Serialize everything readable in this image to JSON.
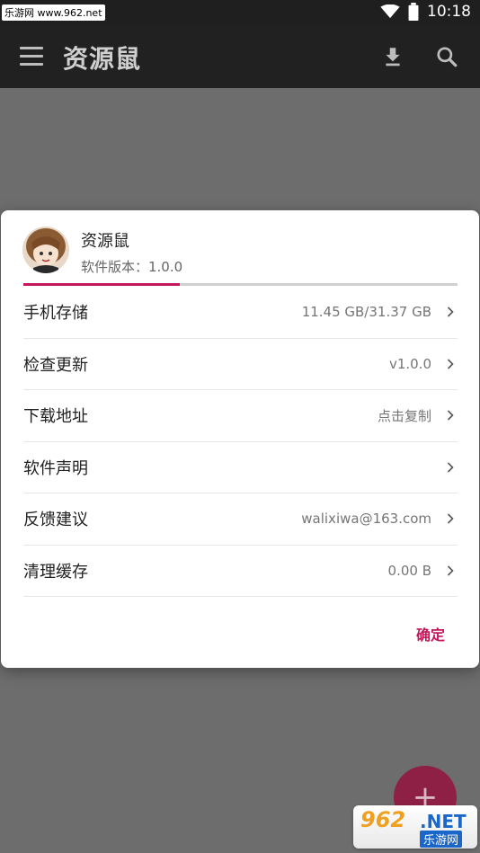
{
  "status_bar": {
    "watermark": "乐游网 www.962.net",
    "time": "10:18"
  },
  "toolbar": {
    "title": "资源鼠",
    "icons": [
      "menu-icon",
      "download-icon",
      "search-icon"
    ]
  },
  "dialog": {
    "app_name": "资源鼠",
    "version": "软件版本：1.0.0",
    "storage_used_fraction": 0.36,
    "rows": [
      {
        "label": "手机存储",
        "value": "11.45 GB/31.37 GB"
      },
      {
        "label": "检查更新",
        "value": "v1.0.0"
      },
      {
        "label": "下载地址",
        "value": "点击复制"
      },
      {
        "label": "软件声明",
        "value": ""
      },
      {
        "label": "反馈建议",
        "value": "walixiwa@163.com"
      },
      {
        "label": "清理缓存",
        "value": "0.00 B"
      }
    ],
    "confirm_label": "确定"
  },
  "fab": {
    "icon": "plus-icon"
  },
  "watermark_br": {
    "brand": "962",
    "suffix": ".NET",
    "name": "乐游网"
  },
  "colors": {
    "accent": "#c2185b",
    "toolbar": "#212121",
    "scrim": "#6d6d6d"
  }
}
